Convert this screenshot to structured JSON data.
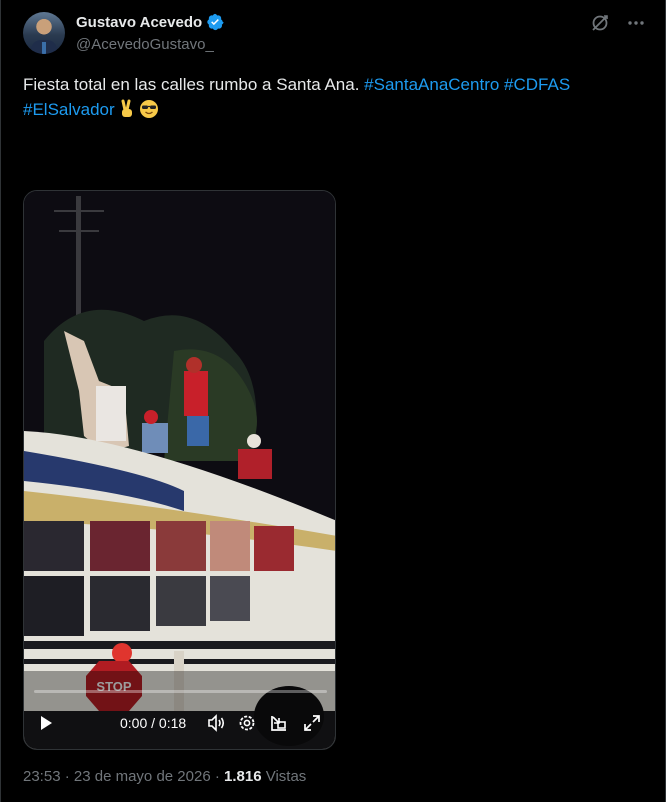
{
  "author": {
    "display_name": "Gustavo Acevedo",
    "handle": "@AcevedoGustavo_",
    "verified": true
  },
  "top_actions": {
    "grok_icon": "grok-icon",
    "more_icon": "more-options-icon"
  },
  "tweet": {
    "text": "Fiesta total en las calles rumbo a Santa Ana.",
    "hashtags": [
      "#SantaAnaCentro",
      "#CDFAS",
      "#ElSalvador"
    ],
    "emojis": [
      "victory-hand",
      "smiling-face-with-sunglasses"
    ]
  },
  "video": {
    "time_display": "0:00 / 0:18",
    "progress": 0,
    "controls": [
      "play-icon",
      "volume-icon",
      "settings-icon",
      "pip-icon",
      "fullscreen-icon"
    ],
    "scene_sign": "STOP"
  },
  "meta": {
    "time": "23:53",
    "sep1": "·",
    "date": "23 de mayo de 2026",
    "sep2": "·",
    "views_count": "1.816",
    "views_label": "Vistas"
  },
  "colors": {
    "background": "#000000",
    "text": "#e7e9ea",
    "muted": "#71767b",
    "accent": "#1d9bf0"
  }
}
